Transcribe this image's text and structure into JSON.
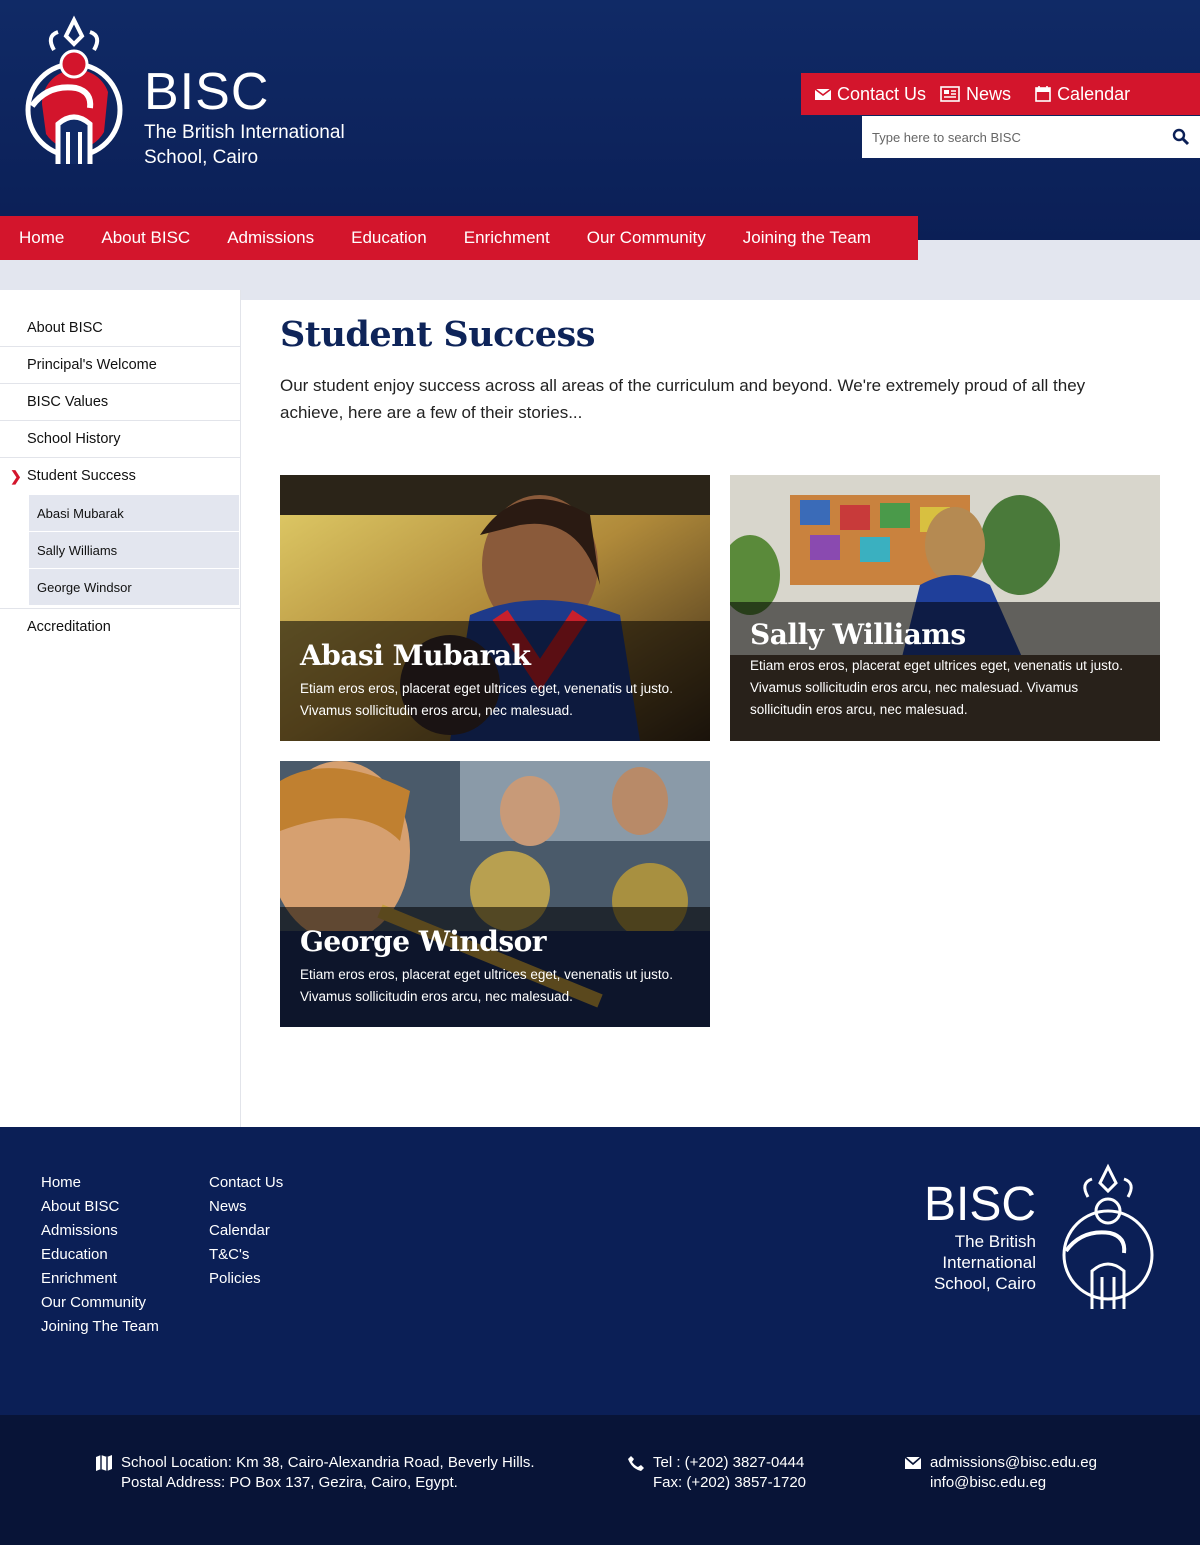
{
  "header": {
    "brand": "BISC",
    "brand_sub_1": "The British International",
    "brand_sub_2": "School, Cairo"
  },
  "utility": {
    "contact": "Contact Us",
    "news": "News",
    "calendar": "Calendar"
  },
  "search": {
    "placeholder": "Type here to search BISC"
  },
  "nav": [
    "Home",
    "About BISC",
    "Admissions",
    "Education",
    "Enrichment",
    "Our Community",
    "Joining the Team"
  ],
  "sidebar": {
    "items": [
      "About BISC",
      "Principal's Welcome",
      "BISC Values",
      "School History",
      "Student Success"
    ],
    "active": "Student Success",
    "subitems": [
      "Abasi Mubarak",
      "Sally Williams",
      "George Windsor"
    ],
    "last": "Accreditation"
  },
  "main": {
    "title": "Student Success",
    "intro": "Our student enjoy success across all areas of the curriculum and beyond. We're extremely proud of all they achieve, here are a few of their stories..."
  },
  "cards": [
    {
      "name": "Abasi Mubarak",
      "text": "Etiam eros eros, placerat eget ultrices eget, venenatis ut justo. Vivamus sollicitudin eros arcu, nec malesuad."
    },
    {
      "name": "Sally Williams",
      "text": "Etiam eros eros, placerat eget ultrices eget, venenatis ut justo. Vivamus sollicitudin eros arcu, nec malesuad. Vivamus sollicitudin eros arcu, nec malesuad."
    },
    {
      "name": "George Windsor",
      "text": "Etiam eros eros, placerat eget ultrices eget, venenatis ut justo. Vivamus sollicitudin eros arcu, nec malesuad."
    }
  ],
  "footer": {
    "col1": [
      "Home",
      "About BISC",
      "Admissions",
      "Education",
      "Enrichment",
      "Our Community",
      "Joining The Team"
    ],
    "col2": [
      "Contact Us",
      "News",
      "Calendar",
      "T&C's",
      "Policies"
    ],
    "brand": "BISC",
    "brand_lines": [
      "The British",
      "International",
      "School, Cairo"
    ]
  },
  "contact": {
    "location": "School Location: Km 38, Cairo-Alexandria Road, Beverly Hills.",
    "postal": "Postal Address: PO Box 137, Gezira, Cairo, Egypt.",
    "tel": "Tel : (+202) 3827-0444",
    "fax": "Fax: (+202) 3857-1720",
    "email1": "admissions@bisc.edu.eg",
    "email2": "info@bisc.edu.eg"
  },
  "colors": {
    "navy": "#0b1f56",
    "red": "#d3152c",
    "grey": "#e3e6ef"
  }
}
